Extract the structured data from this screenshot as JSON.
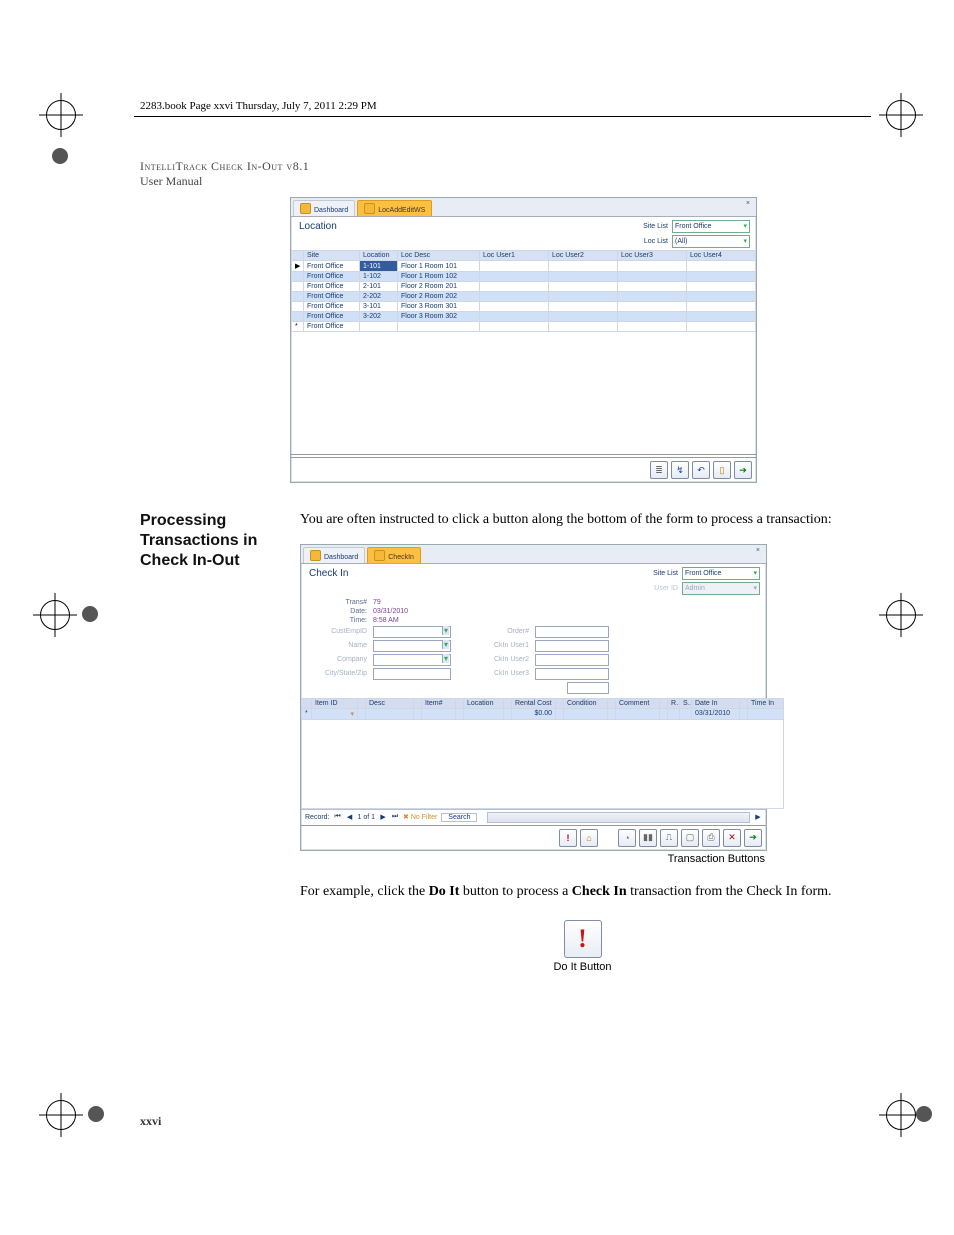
{
  "running_head": "2283.book  Page xxvi  Thursday, July 7, 2011  2:29 PM",
  "doc_header": {
    "prodname": "IntelliTrack Check In-Out v8.1",
    "subtitle": "User Manual"
  },
  "section_heading": "Processing Transactions in Check In-Out",
  "intro_para": "You are often instructed to click a button along the bottom of the form to process a transaction:",
  "explain_para": {
    "p1": "For example, click the ",
    "b1": "Do It",
    "p2": " button to process a ",
    "b2": "Check In",
    "p3": " transaction from the Check In form."
  },
  "page_number": "xxvi",
  "shot1": {
    "tabs": [
      {
        "label": "Dashboard",
        "active": false
      },
      {
        "label": "LocAddEditWS",
        "active": true
      }
    ],
    "title": "Location",
    "header_selectors": {
      "site_label": "Site List",
      "site_value": "Front Office",
      "loc_label": "Loc List",
      "loc_value": "(All)"
    },
    "columns": [
      "",
      "Site",
      "Location",
      "Loc Desc",
      "Loc User1",
      "Loc User2",
      "Loc User3",
      "Loc User4"
    ],
    "rows": [
      {
        "mark": "▶",
        "site": "Front Office",
        "loc": "1-101",
        "desc": "Floor 1 Room 101",
        "edit": true
      },
      {
        "mark": "",
        "site": "Front Office",
        "loc": "1-102",
        "desc": "Floor 1 Room 102",
        "alt": true
      },
      {
        "mark": "",
        "site": "Front Office",
        "loc": "2-101",
        "desc": "Floor 2 Room 201"
      },
      {
        "mark": "",
        "site": "Front Office",
        "loc": "2-202",
        "desc": "Floor 2 Room 202",
        "alt": true
      },
      {
        "mark": "",
        "site": "Front Office",
        "loc": "3-101",
        "desc": "Floor 3 Room 301"
      },
      {
        "mark": "",
        "site": "Front Office",
        "loc": "3-202",
        "desc": "Floor 3 Room 302",
        "alt": true
      },
      {
        "mark": "*",
        "site": "Front Office",
        "loc": "",
        "desc": ""
      }
    ]
  },
  "shot2": {
    "tabs": [
      {
        "label": "Dashboard",
        "active": false
      },
      {
        "label": "CheckIn",
        "active": true
      }
    ],
    "title": "Check In",
    "header_selectors": {
      "site_label": "Site List",
      "site_value": "Front Office",
      "user_label": "User ID",
      "user_value": "Admin"
    },
    "form": {
      "trans_label": "Trans#",
      "trans_value": "79",
      "date_label": "Date:",
      "date_value": "03/31/2010",
      "time_label": "Time:",
      "time_value": "8:58 AM",
      "cust_label": "CustEmpID",
      "name_label": "Name",
      "company_label": "Company",
      "csz_label": "City/State/Zip",
      "order_label": "Order#",
      "u1_label": "CkIn User1",
      "u2_label": "CkIn User2",
      "u3_label": "CkIn User3"
    },
    "grid_columns": [
      "",
      "Item ID",
      "",
      "Desc",
      "",
      "Item#",
      "",
      "Location",
      "",
      "Rental Cost",
      "",
      "Condition",
      "",
      "Comment",
      "",
      "R…",
      "S…",
      "Date In",
      "",
      "Time In"
    ],
    "grid_row": {
      "rental": "$0.00",
      "date_in": "03/31/2010"
    },
    "recbar": {
      "text": "Record:",
      "pos": "1 of 1",
      "nofilter": "No Filter",
      "search": "Search"
    },
    "toolbar_caption": "Transaction Buttons",
    "doit_caption": "Do It Button",
    "doit_glyph": "!"
  }
}
